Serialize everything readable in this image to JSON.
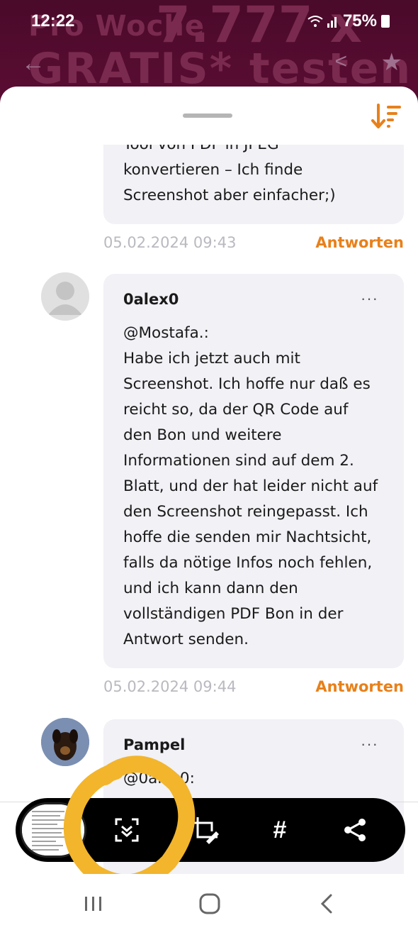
{
  "status_bar": {
    "time": "12:22",
    "battery": "75%"
  },
  "background_banner": {
    "line1": "Pro Woche",
    "line2": "7.777 x",
    "line3": "GRATIS* testen"
  },
  "comments": [
    {
      "text": "Tool von PDF in JPEG\nkonvertieren – Ich finde\nScreenshot aber einfacher;)",
      "date": "05.02.2024 09:43",
      "reply_label": "Antworten"
    },
    {
      "author": "0alex0",
      "text": "@Mostafa.:\nHabe ich jetzt auch mit\nScreenshot. Ich hoffe nur daß es\nreicht so, da der QR Code auf\nden Bon und weitere\nInformationen sind auf dem 2.\nBlatt, und der hat leider nicht auf\nden Screenshot reingepasst. Ich\nhoffe die senden mir Nachtsicht,\nfalls da nötige Infos noch fehlen,\nund ich kann dann den\nvollständigen PDF Bon in der\nAntwort senden.",
      "date": "05.02.2024 09:44",
      "reply_label": "Antworten",
      "more": "···"
    },
    {
      "author": "Pampel",
      "text": "@0alex0:",
      "more": "···"
    }
  ],
  "toolbar": {
    "hash_label": "#",
    "icons": [
      "screenshot-thumbnail",
      "scroll-capture-icon",
      "crop-edit-icon",
      "hashtag-icon",
      "share-icon"
    ]
  },
  "colors": {
    "accent": "#e8801a",
    "bubble": "#f1f1f6",
    "highlight": "#f2b52c"
  }
}
